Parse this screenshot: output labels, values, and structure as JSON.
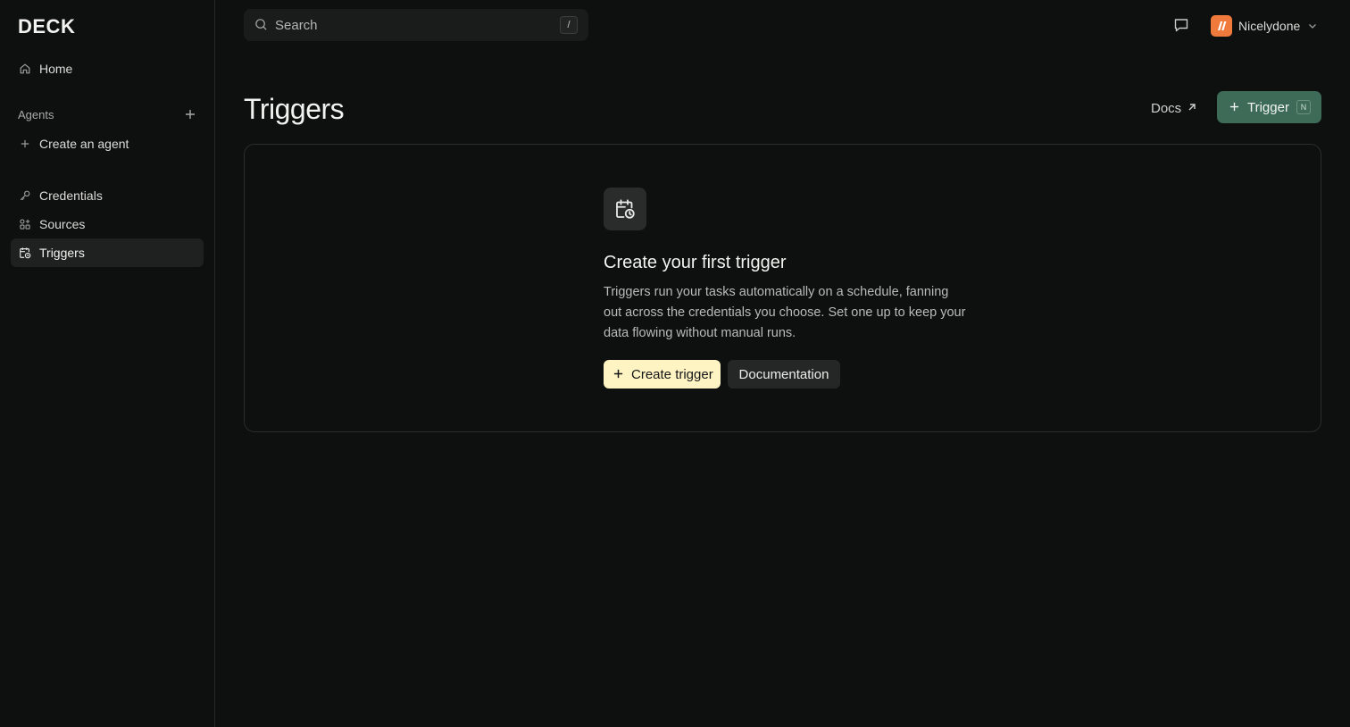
{
  "app": {
    "logo": "DECK"
  },
  "search": {
    "placeholder": "Search",
    "shortcut": "/"
  },
  "account": {
    "name": "Nicelydone",
    "avatar_color": "#f07a3c"
  },
  "sidebar": {
    "home_label": "Home",
    "agents_section_label": "Agents",
    "create_agent_label": "Create an agent",
    "items": [
      {
        "label": "Credentials",
        "icon": "key-icon"
      },
      {
        "label": "Sources",
        "icon": "sources-icon"
      },
      {
        "label": "Triggers",
        "icon": "calendar-clock-icon",
        "active": true
      }
    ]
  },
  "header": {
    "title": "Triggers",
    "docs_label": "Docs",
    "new_trigger_label": "Trigger",
    "new_trigger_shortcut": "N",
    "accent_color": "#3d6b58"
  },
  "empty_state": {
    "icon": "calendar-clock-icon",
    "title": "Create your first trigger",
    "description": "Triggers run your tasks automatically on a schedule, fanning out across the credentials you choose. Set one up to keep your data flowing without manual runs.",
    "primary_label": "Create trigger",
    "secondary_label": "Documentation",
    "primary_color": "#fdf3c3"
  }
}
